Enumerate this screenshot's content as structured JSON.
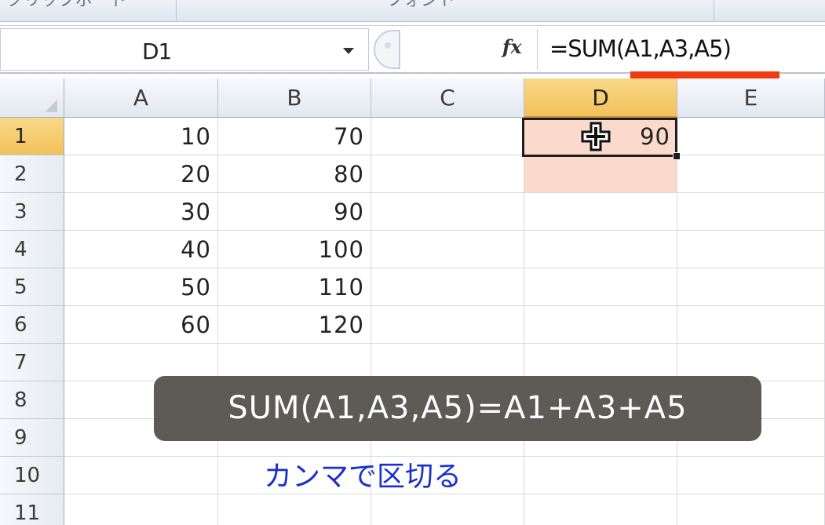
{
  "ribbon": {
    "group1_label": "クリップボード",
    "group2_label": "フォント"
  },
  "formula_bar": {
    "name_box": "D1",
    "fx_label": "fx",
    "formula": "=SUM(A1,A3,A5)"
  },
  "sheet": {
    "columns": [
      "A",
      "B",
      "C",
      "D",
      "E"
    ],
    "active_column": "D",
    "rows": [
      "1",
      "2",
      "3",
      "4",
      "5",
      "6",
      "7",
      "8",
      "9",
      "10",
      "11"
    ],
    "active_row": "1",
    "cells": {
      "A": [
        "10",
        "20",
        "30",
        "40",
        "50",
        "60"
      ],
      "B": [
        "70",
        "80",
        "90",
        "100",
        "110",
        "120"
      ],
      "D1": "90"
    }
  },
  "overlay": {
    "caption": "SUM(A1,A3,A5)=A1+A3+A5",
    "note": "カンマで区切る"
  },
  "colors": {
    "highlight_underline": "#f13a0f",
    "header_active": "#f2c15a",
    "cell_tint": "#fbd9cb",
    "note_text": "#1a2fd0"
  }
}
